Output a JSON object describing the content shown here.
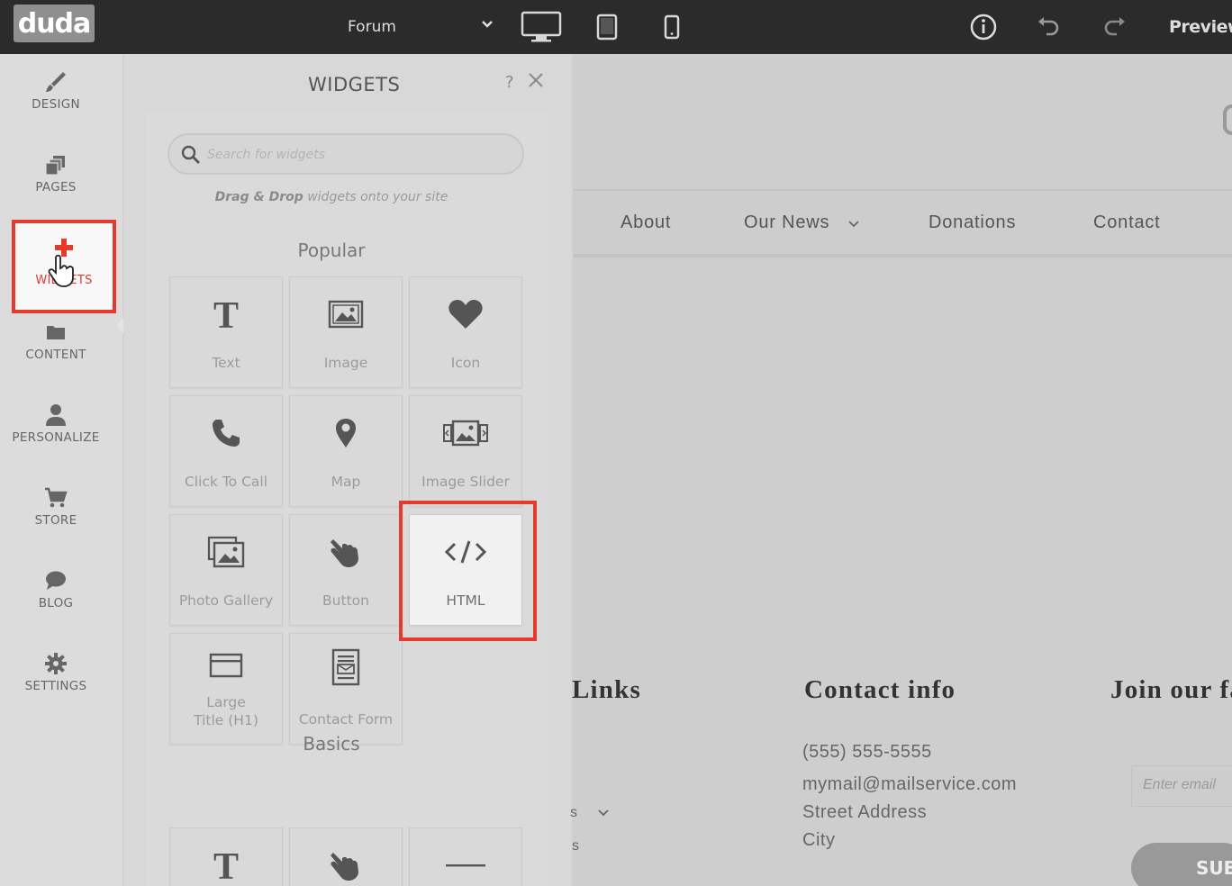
{
  "topbar": {
    "logo": "duda",
    "page_selector": "Forum",
    "preview_label": "Preview"
  },
  "leftnav": {
    "items": [
      {
        "label": "DESIGN",
        "icon": "brush-icon"
      },
      {
        "label": "PAGES",
        "icon": "pages-icon"
      },
      {
        "label": "WIDGETS",
        "icon": "plus-icon"
      },
      {
        "label": "CONTENT",
        "icon": "folder-icon"
      },
      {
        "label": "PERSONALIZE",
        "icon": "person-icon"
      },
      {
        "label": "STORE",
        "icon": "cart-icon"
      },
      {
        "label": "BLOG",
        "icon": "chat-bubble-icon"
      },
      {
        "label": "SETTINGS",
        "icon": "gear-icon"
      }
    ]
  },
  "panel": {
    "title": "WIDGETS",
    "help": "?",
    "search_placeholder": "Search for widgets",
    "hint_bold": "Drag & Drop",
    "hint_rest": " widgets onto your site",
    "popular_title": "Popular",
    "basics_title": "Basics",
    "popular": [
      {
        "label": "Text",
        "icon": "text-icon"
      },
      {
        "label": "Image",
        "icon": "image-icon"
      },
      {
        "label": "Icon",
        "icon": "heart-icon"
      },
      {
        "label": "Click To Call",
        "icon": "phone-icon"
      },
      {
        "label": "Map",
        "icon": "map-pin-icon"
      },
      {
        "label": "Image Slider",
        "icon": "image-slider-icon"
      },
      {
        "label": "Photo Gallery",
        "icon": "photo-gallery-icon"
      },
      {
        "label": "Button",
        "icon": "pointer-hand-icon"
      },
      {
        "label": "HTML",
        "icon": "code-icon"
      },
      {
        "label_line1": "Large",
        "label_line2": "Title (H1)",
        "icon": "title-box-icon"
      },
      {
        "label": "Contact Form",
        "icon": "contact-form-icon"
      }
    ],
    "basics": [
      {
        "icon": "text-icon"
      },
      {
        "icon": "pointer-hand-icon"
      },
      {
        "icon": "divider-icon"
      }
    ]
  },
  "site": {
    "nav": [
      "About",
      "Our News",
      "Donations",
      "Contact"
    ],
    "footer": {
      "links_heading": "Links",
      "contact_heading": "Contact info",
      "join_heading": "Join our fa",
      "phone": "(555) 555-5555",
      "email": "mymail@mailservice.com",
      "street": "Street Address",
      "city": "City",
      "links_partial_1": "s",
      "links_partial_2": "s",
      "email_placeholder": "Enter email",
      "subscribe": "SUB"
    }
  }
}
